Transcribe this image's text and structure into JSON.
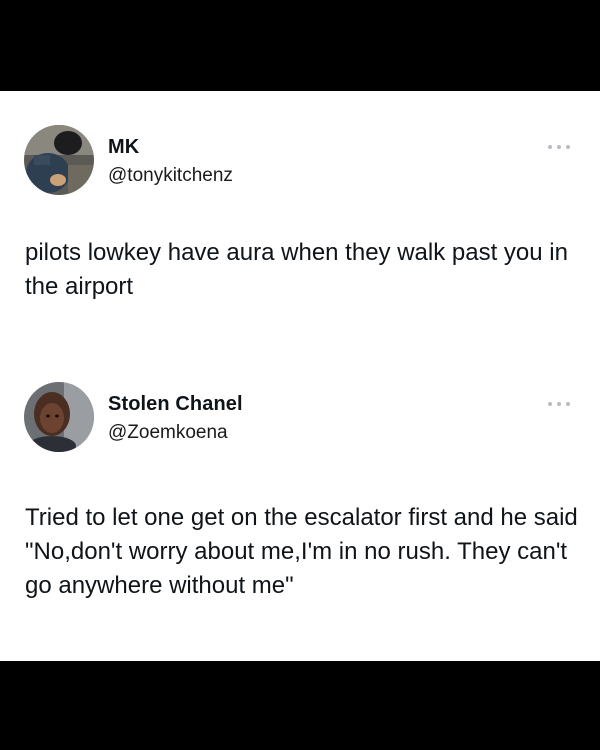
{
  "tweets": [
    {
      "display_name": "MK",
      "handle": "@tonykitchenz",
      "text": "pilots lowkey have aura when they walk past you in the airport",
      "avatar_icon": "user-photo-avatar",
      "more_icon": "more-options-icon"
    },
    {
      "display_name": "Stolen Chanel",
      "handle": "@Zoemkoena",
      "text": "Tried to let one get on the escalator first and he said \"No,don't worry about me,I'm in no rush. They can't go anywhere without me\"",
      "avatar_icon": "user-photo-avatar",
      "more_icon": "more-options-icon"
    }
  ],
  "colors": {
    "background_frame": "#000000",
    "card": "#ffffff",
    "text_primary": "#0f1419",
    "more_dots": "#b8bcc2"
  }
}
